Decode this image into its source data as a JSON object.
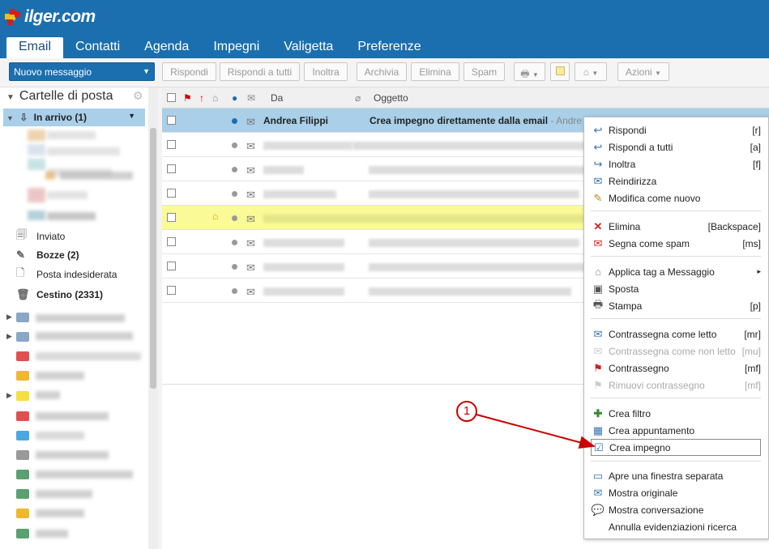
{
  "app": {
    "logo_text": "ilger.com"
  },
  "tabs": [
    {
      "label": "Email"
    },
    {
      "label": "Contatti"
    },
    {
      "label": "Agenda"
    },
    {
      "label": "Impegni"
    },
    {
      "label": "Valigetta"
    },
    {
      "label": "Preferenze"
    }
  ],
  "toolbar": {
    "new_message": "Nuovo messaggio",
    "reply": "Rispondi",
    "reply_all": "Rispondi a tutti",
    "forward": "Inoltra",
    "archive": "Archivia",
    "delete": "Elimina",
    "spam": "Spam",
    "actions": "Azioni"
  },
  "sidebar": {
    "title": "Cartelle di posta",
    "inbox": "In arrivo (1)",
    "sent": "Inviato",
    "drafts": "Bozze (2)",
    "junk": "Posta indesiderata",
    "trash": "Cestino (2331)"
  },
  "list": {
    "col_from": "Da",
    "col_subject": "Oggetto",
    "selected_from": "Andrea Filippi",
    "selected_subject": "Crea impegno direttamente dalla email",
    "selected_preview": " - Andre"
  },
  "context_menu": {
    "items": [
      {
        "label": "Rispondi",
        "key": "[r]"
      },
      {
        "label": "Rispondi a tutti",
        "key": "[a]"
      },
      {
        "label": "Inoltra",
        "key": "[f]"
      },
      {
        "label": "Reindirizza",
        "key": ""
      },
      {
        "label": "Modifica come nuovo",
        "key": ""
      },
      {
        "label": "Elimina",
        "key": "[Backspace]"
      },
      {
        "label": "Segna come spam",
        "key": "[ms]"
      },
      {
        "label": "Applica tag a Messaggio",
        "key": "▸"
      },
      {
        "label": "Sposta",
        "key": ""
      },
      {
        "label": "Stampa",
        "key": "[p]"
      },
      {
        "label": "Contrassegna come letto",
        "key": "[mr]"
      },
      {
        "label": "Contrassegna come non letto",
        "key": "[mu]"
      },
      {
        "label": "Contrassegno",
        "key": "[mf]"
      },
      {
        "label": "Rimuovi contrassegno",
        "key": "[mf]"
      },
      {
        "label": "Crea filtro",
        "key": ""
      },
      {
        "label": "Crea appuntamento",
        "key": ""
      },
      {
        "label": "Crea impegno",
        "key": ""
      },
      {
        "label": "Apre una finestra separata",
        "key": ""
      },
      {
        "label": "Mostra originale",
        "key": ""
      },
      {
        "label": "Mostra conversazione",
        "key": ""
      },
      {
        "label": "Annulla evidenziazioni ricerca",
        "key": ""
      }
    ]
  },
  "annotation": {
    "number": "1"
  },
  "colors": {
    "header": "#1b6fae",
    "selection": "#a9cfe9",
    "highlight_row": "#fafa96",
    "callout": "#cc0000"
  }
}
